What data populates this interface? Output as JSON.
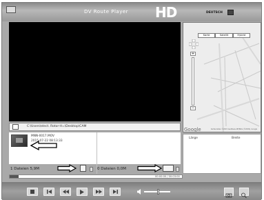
{
  "titlebar": {
    "title": "DV Route Player",
    "logo": "HD",
    "language": "DEUTSCH",
    "icons": [
      "app-icon",
      "flag-icon"
    ]
  },
  "path": {
    "text": "C:\\Users\\elect. Rotor-H=\\Desktop\\CAM"
  },
  "file": {
    "name": "MNN-0017.MOV",
    "date": "2015-07-22  08:13:33"
  },
  "info": {
    "left": "1 Dateien 5,9M",
    "right": "0 Dateien 0,0M"
  },
  "progress": {
    "time": "00:00:00 / 00:03:00",
    "fraction": 0.05
  },
  "map": {
    "tabs": [
      "Karte",
      "Satellit",
      "Hybrid"
    ],
    "provider": "Google",
    "copyright": "Kartendaten ©2015 GeoBasis-DE/BKG (©2009), Google",
    "coord_labels": [
      "Länge",
      "Breite"
    ]
  },
  "controls": {
    "buttons": [
      "stop-button",
      "previous-button",
      "rewind-button",
      "play-button",
      "forward-button",
      "next-button"
    ],
    "volume": 0.5,
    "right_buttons": [
      "snapshot-button",
      "zoom-button"
    ]
  }
}
